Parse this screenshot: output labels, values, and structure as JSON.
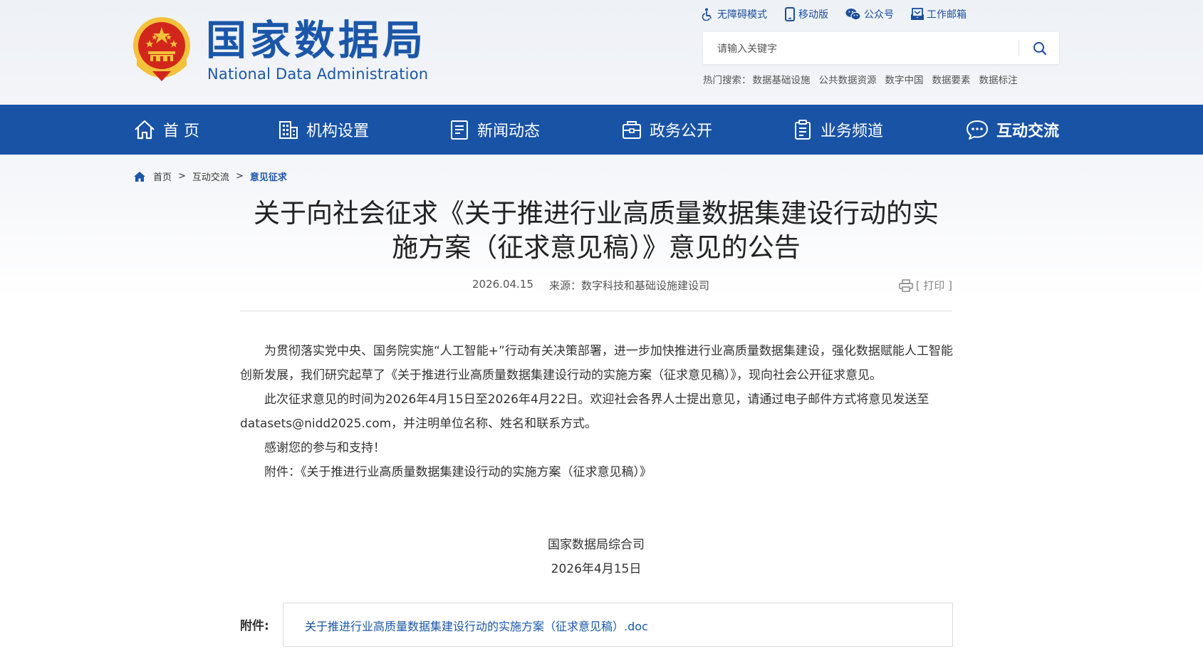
{
  "site": {
    "name_cn": "国家数据局",
    "name_en": "National Data Administration"
  },
  "top_links": [
    {
      "label": "无障碍模式",
      "icon": "accessibility-icon"
    },
    {
      "label": "移动版",
      "icon": "mobile-icon"
    },
    {
      "label": "公众号",
      "icon": "wechat-icon"
    },
    {
      "label": "工作邮箱",
      "icon": "mail-icon"
    }
  ],
  "search": {
    "placeholder": "请输入关键字",
    "hot_label": "热门搜索：",
    "hot_terms": [
      "数据基础设施",
      "公共数据资源",
      "数字中国",
      "数据要素",
      "数据标注"
    ]
  },
  "nav": [
    {
      "label": "首 页",
      "icon": "home-icon"
    },
    {
      "label": "机构设置",
      "icon": "building-icon"
    },
    {
      "label": "新闻动态",
      "icon": "news-icon"
    },
    {
      "label": "政务公开",
      "icon": "briefcase-icon"
    },
    {
      "label": "业务频道",
      "icon": "clipboard-icon"
    },
    {
      "label": "互动交流",
      "icon": "chat-icon"
    }
  ],
  "breadcrumb": {
    "items": [
      "首页",
      "互动交流",
      "意见征求"
    ],
    "separator": ">"
  },
  "article": {
    "title_line1": "关于向社会征求《关于推进行业高质量数据集建设行动的实",
    "title_line2": "施方案（征求意见稿）》意见的公告",
    "date": "2026.04.15",
    "source": "来源：数字科技和基础设施建设司",
    "print_label": "[ 打印 ]",
    "paragraphs": [
      "为贯彻落实党中央、国务院实施“人工智能+”行动有关决策部署，进一步加快推进行业高质量数据集建设，强化数据赋能人工智能创新发展，我们研究起草了《关于推进行业高质量数据集建设行动的实施方案（征求意见稿）》，现向社会公开征求意见。",
      "此次征求意见的时间为2026年4月15日至2026年4月22日。欢迎社会各界人士提出意见，请通过电子邮件方式将意见发送至datasets@nidd2025.com，并注明单位名称、姓名和联系方式。",
      "感谢您的参与和支持！",
      "附件：《关于推进行业高质量数据集建设行动的实施方案（征求意见稿）》"
    ],
    "signature": "国家数据局综合司",
    "sign_date": "2026年4月15日",
    "attachment_label": "附件:",
    "attachment_file": "关于推进行业高质量数据集建设行动的实施方案（征求意见稿）.doc"
  },
  "colors": {
    "brand_blue": "#1b57a9",
    "nav_bg": "#1853a6",
    "emblem_red": "#d2261d",
    "emblem_gold": "#f3c13a"
  }
}
